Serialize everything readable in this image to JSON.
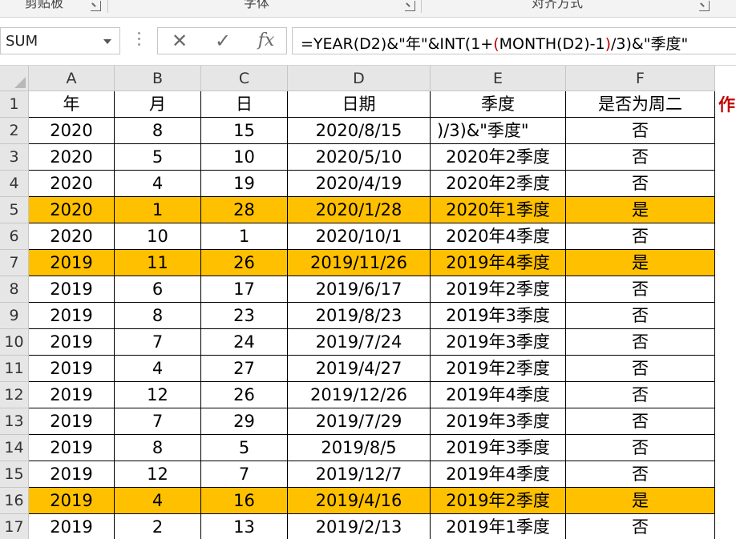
{
  "ribbon": {
    "groups": [
      "剪贴板",
      "字体",
      "对齐方式"
    ]
  },
  "formula_bar": {
    "name_box": "SUM",
    "cancel_icon": "✕",
    "enter_icon": "✓",
    "fx_label": "fx",
    "formula_parts": [
      "=YEAR(D2)&\"年\"&INT(1+",
      "(",
      "MONTH(D2)-1",
      ")",
      "/3)&\"季度\""
    ]
  },
  "grid": {
    "columns": [
      "A",
      "B",
      "C",
      "D",
      "E",
      "F"
    ],
    "headers": [
      "年",
      "月",
      "日",
      "日期",
      "季度",
      "是否为周二"
    ],
    "overflow_header": "作",
    "editing_cell_text": ")/3)&\"季度\"",
    "rows": [
      {
        "num": "1",
        "cells": [
          "年",
          "月",
          "日",
          "日期",
          "季度",
          "是否为周二"
        ],
        "highlight": false
      },
      {
        "num": "2",
        "cells": [
          "2020",
          "8",
          "15",
          "2020/8/15",
          ")/3)&\"季度\"",
          "否"
        ],
        "highlight": false
      },
      {
        "num": "3",
        "cells": [
          "2020",
          "5",
          "10",
          "2020/5/10",
          "2020年2季度",
          "否"
        ],
        "highlight": false
      },
      {
        "num": "4",
        "cells": [
          "2020",
          "4",
          "19",
          "2020/4/19",
          "2020年2季度",
          "否"
        ],
        "highlight": false
      },
      {
        "num": "5",
        "cells": [
          "2020",
          "1",
          "28",
          "2020/1/28",
          "2020年1季度",
          "是"
        ],
        "highlight": true
      },
      {
        "num": "6",
        "cells": [
          "2020",
          "10",
          "1",
          "2020/10/1",
          "2020年4季度",
          "否"
        ],
        "highlight": false
      },
      {
        "num": "7",
        "cells": [
          "2019",
          "11",
          "26",
          "2019/11/26",
          "2019年4季度",
          "是"
        ],
        "highlight": true
      },
      {
        "num": "8",
        "cells": [
          "2019",
          "6",
          "17",
          "2019/6/17",
          "2019年2季度",
          "否"
        ],
        "highlight": false
      },
      {
        "num": "9",
        "cells": [
          "2019",
          "8",
          "23",
          "2019/8/23",
          "2019年3季度",
          "否"
        ],
        "highlight": false
      },
      {
        "num": "10",
        "cells": [
          "2019",
          "7",
          "24",
          "2019/7/24",
          "2019年3季度",
          "否"
        ],
        "highlight": false
      },
      {
        "num": "11",
        "cells": [
          "2019",
          "4",
          "27",
          "2019/4/27",
          "2019年2季度",
          "否"
        ],
        "highlight": false
      },
      {
        "num": "12",
        "cells": [
          "2019",
          "12",
          "26",
          "2019/12/26",
          "2019年4季度",
          "否"
        ],
        "highlight": false
      },
      {
        "num": "13",
        "cells": [
          "2019",
          "7",
          "29",
          "2019/7/29",
          "2019年3季度",
          "否"
        ],
        "highlight": false
      },
      {
        "num": "14",
        "cells": [
          "2019",
          "8",
          "5",
          "2019/8/5",
          "2019年3季度",
          "否"
        ],
        "highlight": false
      },
      {
        "num": "15",
        "cells": [
          "2019",
          "12",
          "7",
          "2019/12/7",
          "2019年4季度",
          "否"
        ],
        "highlight": false
      },
      {
        "num": "16",
        "cells": [
          "2019",
          "4",
          "16",
          "2019/4/16",
          "2019年2季度",
          "是"
        ],
        "highlight": true
      },
      {
        "num": "17",
        "cells": [
          "2019",
          "2",
          "13",
          "2019/2/13",
          "2019年1季度",
          "否"
        ],
        "highlight": false
      }
    ]
  },
  "colors": {
    "highlight": "#ffc000",
    "header_bg": "#e6e6e6",
    "formula_red": "#c00000"
  }
}
